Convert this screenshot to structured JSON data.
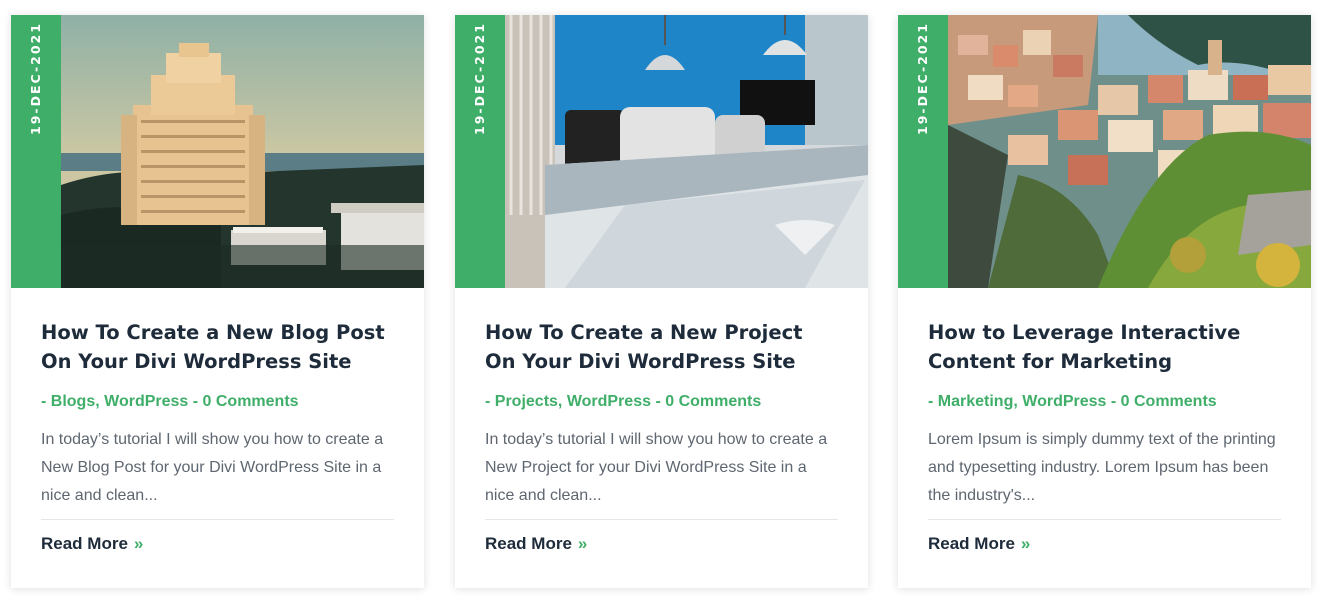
{
  "colors": {
    "accent": "#3fae69",
    "heading": "#1e2b3a",
    "text": "#5e6670"
  },
  "posts": [
    {
      "date": "19-DEC-2021",
      "image": "hotel-resort-photo",
      "title": "How To Create a New Blog Post On Your Divi WordPress Site",
      "meta_prefix": "- ",
      "categories": [
        "Blogs",
        "WordPress"
      ],
      "comments": "0 Comments",
      "excerpt": "In today’s tutorial I will show you how to create a New Blog Post for your Divi WordPress Site in a nice and clean...",
      "read_more": "Read More",
      "read_more_icon": "double-chevron-right-icon"
    },
    {
      "date": "19-DEC-2021",
      "image": "office-meeting-room-photo",
      "title": "How To Create a New Project On Your Divi WordPress Site",
      "meta_prefix": "- ",
      "categories": [
        "Projects",
        "WordPress"
      ],
      "comments": "0 Comments",
      "excerpt": "In today’s tutorial I will show you how to create a New Project for your Divi WordPress Site in a nice and clean...",
      "read_more": "Read More",
      "read_more_icon": "double-chevron-right-icon"
    },
    {
      "date": "19-DEC-2021",
      "image": "coastal-village-photo",
      "title": "How to Leverage Interactive Content for Marketing",
      "meta_prefix": "- ",
      "categories": [
        "Marketing",
        "WordPress"
      ],
      "comments": "0 Comments",
      "excerpt": "Lorem Ipsum is simply dummy text of the printing and typesetting industry. Lorem Ipsum has been the industry's...",
      "read_more": "Read More",
      "read_more_icon": "double-chevron-right-icon"
    }
  ]
}
